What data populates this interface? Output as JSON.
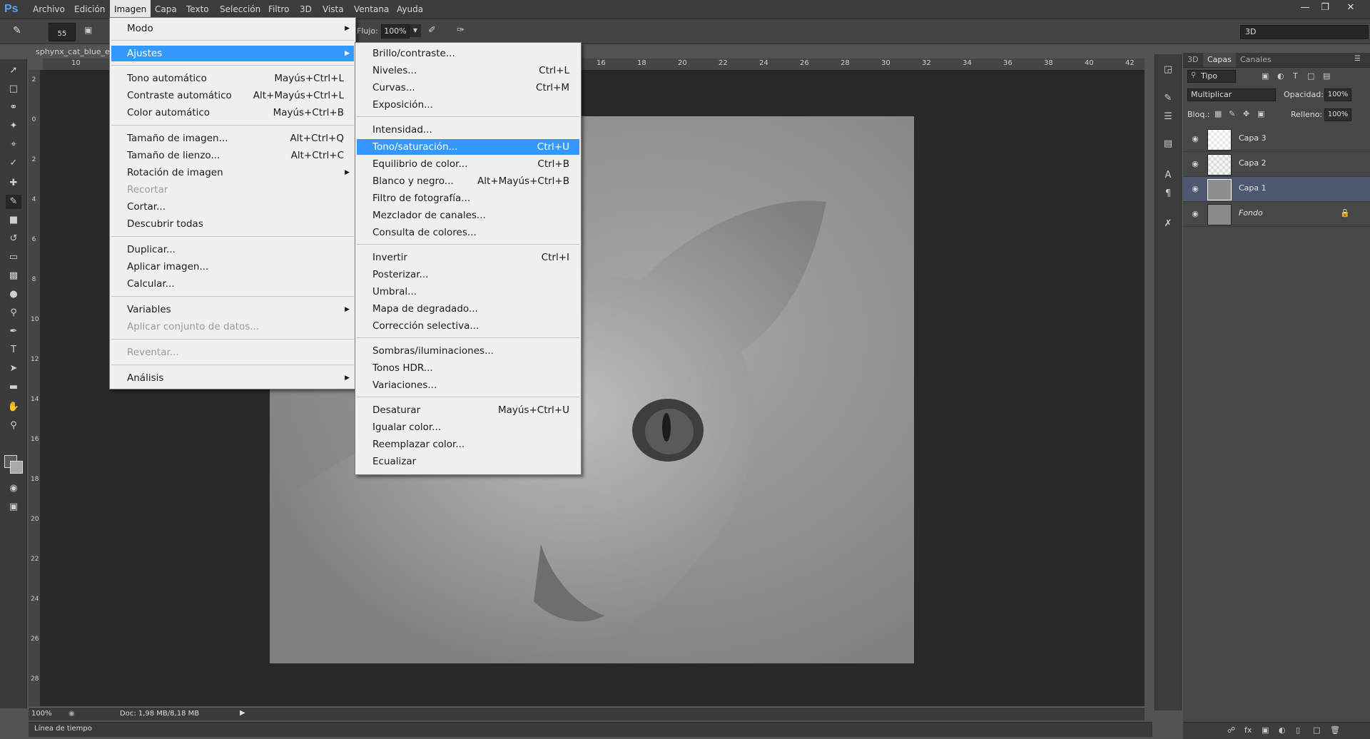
{
  "app": {
    "logo": "Ps"
  },
  "menubar": [
    {
      "label": "Archivo"
    },
    {
      "label": "Edición"
    },
    {
      "label": "Imagen",
      "active": true
    },
    {
      "label": "Capa"
    },
    {
      "label": "Texto"
    },
    {
      "label": "Selección"
    },
    {
      "label": "Filtro"
    },
    {
      "label": "3D"
    },
    {
      "label": "Vista"
    },
    {
      "label": "Ventana"
    },
    {
      "label": "Ayuda"
    }
  ],
  "window_controls": [
    "minimize-icon",
    "restore-icon",
    "close-icon"
  ],
  "options_bar": {
    "brush_size": "55",
    "flow_label": "Flujo:",
    "flow_value": "100%",
    "workspace": "3D"
  },
  "document": {
    "tab_title": "sphynx_cat_blue_e",
    "zoom": "100%",
    "doc_info": "Doc: 1,98 MB/8,18 MB",
    "timeline_label": "Línea de tiempo"
  },
  "ruler": {
    "h_ticks": [
      "10",
      "16",
      "18",
      "20",
      "22",
      "24",
      "26",
      "28",
      "30",
      "32",
      "34",
      "36",
      "38",
      "40",
      "42"
    ],
    "v_ticks": [
      "2",
      "0",
      "2",
      "4",
      "6",
      "8",
      "10",
      "12",
      "14",
      "16",
      "18",
      "20",
      "22",
      "24",
      "26",
      "28"
    ]
  },
  "layers_panel": {
    "tabs": [
      "3D",
      "Capas",
      "Canales"
    ],
    "active_tab": "Capas",
    "filter_kind": "Tipo",
    "blend_mode": "Multiplicar",
    "opacity_label": "Opacidad:",
    "opacity_value": "100%",
    "lock_label": "Bloq.:",
    "fill_label": "Relleno:",
    "fill_value": "100%",
    "layers": [
      {
        "name": "Capa 3",
        "selected": false
      },
      {
        "name": "Capa 2",
        "selected": false
      },
      {
        "name": "Capa 1",
        "selected": true
      },
      {
        "name": "Fondo",
        "selected": false,
        "locked": true
      }
    ]
  },
  "imagen_menu": {
    "items": [
      {
        "label": "Modo",
        "shortcut": "",
        "submenu": true
      },
      {
        "label": "Ajustes",
        "shortcut": "",
        "submenu": true,
        "highlighted": true
      },
      {
        "label": "Tono automático",
        "shortcut": "Mayús+Ctrl+L"
      },
      {
        "label": "Contraste automático",
        "shortcut": "Alt+Mayús+Ctrl+L"
      },
      {
        "label": "Color automático",
        "shortcut": "Mayús+Ctrl+B"
      },
      {
        "label": "Tamaño de imagen...",
        "shortcut": "Alt+Ctrl+Q"
      },
      {
        "label": "Tamaño de lienzo...",
        "shortcut": "Alt+Ctrl+C"
      },
      {
        "label": "Rotación de imagen",
        "shortcut": "",
        "submenu": true
      },
      {
        "label": "Recortar",
        "shortcut": "",
        "disabled": true
      },
      {
        "label": "Cortar...",
        "shortcut": ""
      },
      {
        "label": "Descubrir todas",
        "shortcut": ""
      },
      {
        "label": "Duplicar...",
        "shortcut": ""
      },
      {
        "label": "Aplicar imagen...",
        "shortcut": ""
      },
      {
        "label": "Calcular...",
        "shortcut": ""
      },
      {
        "label": "Variables",
        "shortcut": "",
        "submenu": true
      },
      {
        "label": "Aplicar conjunto de datos...",
        "shortcut": "",
        "disabled": true
      },
      {
        "label": "Reventar...",
        "shortcut": "",
        "disabled": true
      },
      {
        "label": "Análisis",
        "shortcut": "",
        "submenu": true
      }
    ]
  },
  "ajustes_menu": {
    "items": [
      {
        "label": "Brillo/contraste...",
        "shortcut": ""
      },
      {
        "label": "Niveles...",
        "shortcut": "Ctrl+L"
      },
      {
        "label": "Curvas...",
        "shortcut": "Ctrl+M"
      },
      {
        "label": "Exposición...",
        "shortcut": ""
      },
      {
        "label": "Intensidad...",
        "shortcut": ""
      },
      {
        "label": "Tono/saturación...",
        "shortcut": "Ctrl+U",
        "highlighted": true
      },
      {
        "label": "Equilibrio de color...",
        "shortcut": "Ctrl+B"
      },
      {
        "label": "Blanco y negro...",
        "shortcut": "Alt+Mayús+Ctrl+B"
      },
      {
        "label": "Filtro de fotografía...",
        "shortcut": ""
      },
      {
        "label": "Mezclador de canales...",
        "shortcut": ""
      },
      {
        "label": "Consulta de colores...",
        "shortcut": ""
      },
      {
        "label": "Invertir",
        "shortcut": "Ctrl+I"
      },
      {
        "label": "Posterizar...",
        "shortcut": ""
      },
      {
        "label": "Umbral...",
        "shortcut": ""
      },
      {
        "label": "Mapa de degradado...",
        "shortcut": ""
      },
      {
        "label": "Corrección selectiva...",
        "shortcut": ""
      },
      {
        "label": "Sombras/iluminaciones...",
        "shortcut": ""
      },
      {
        "label": "Tonos HDR...",
        "shortcut": ""
      },
      {
        "label": "Variaciones...",
        "shortcut": ""
      },
      {
        "label": "Desaturar",
        "shortcut": "Mayús+Ctrl+U"
      },
      {
        "label": "Igualar color...",
        "shortcut": ""
      },
      {
        "label": "Reemplazar color...",
        "shortcut": ""
      },
      {
        "label": "Ecualizar",
        "shortcut": ""
      }
    ]
  },
  "colors": {
    "highlight": "#3399ff",
    "menu_bg": "#f0f0f0",
    "app_bg": "#535353"
  }
}
